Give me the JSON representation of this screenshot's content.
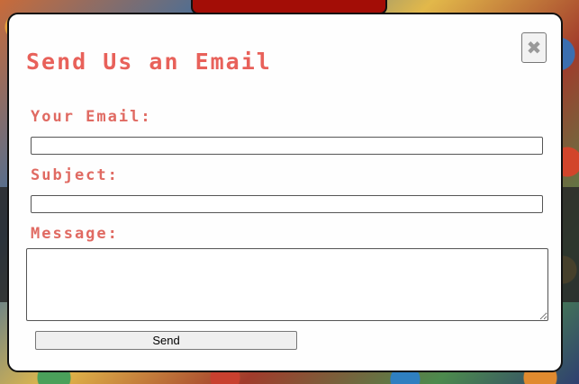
{
  "modal": {
    "title": "Send Us an Email",
    "close_label": "✖",
    "email_label": "Your Email:",
    "email_value": "",
    "subject_label": "Subject:",
    "subject_value": "",
    "message_label": "Message:",
    "message_value": "",
    "send_label": "Send"
  },
  "colors": {
    "label_color": "#e8615a",
    "top_button": "#a30d06"
  }
}
